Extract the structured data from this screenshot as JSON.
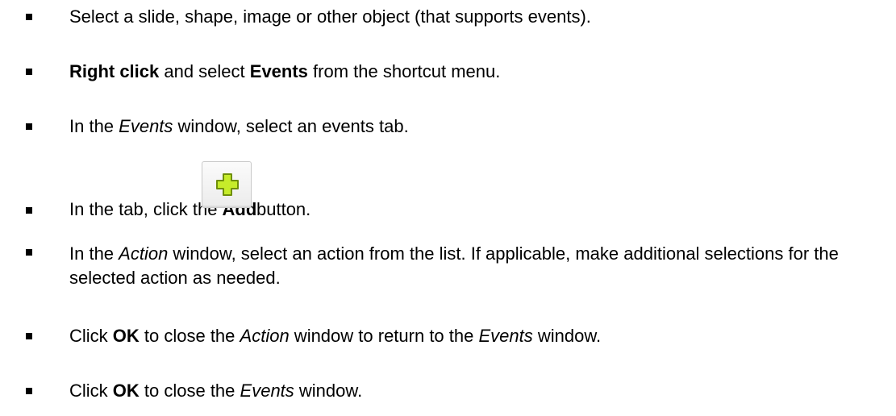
{
  "steps": [
    {
      "parts": [
        "Select a slide, shape, image or other object (that supports events)."
      ]
    },
    {
      "parts": [
        "Right click",
        " and select ",
        "Events",
        " from the shortcut menu."
      ]
    },
    {
      "parts": [
        "In the ",
        "Events",
        " window, select an events tab."
      ]
    },
    {
      "parts": [
        "In the tab, click the ",
        "Add",
        " button."
      ],
      "button_icon": "plus-icon"
    },
    {
      "line1": "In the Action window, select an action from the list. If applicable, make additional",
      "parts": [
        "In the ",
        "Action",
        " window, select an action from the list. If applicable, make additional selections for the selected action as needed."
      ]
    },
    {
      "parts": [
        "Click ",
        "OK",
        " to close the ",
        "Action",
        " window to return to the ",
        "Events",
        " window."
      ]
    },
    {
      "parts": [
        "Click ",
        "OK",
        " to close the ",
        "Events",
        " window."
      ]
    }
  ],
  "colors": {
    "text": "#000000",
    "plus_fill": "#c6ec2a",
    "plus_stroke": "#6f8f0a"
  }
}
